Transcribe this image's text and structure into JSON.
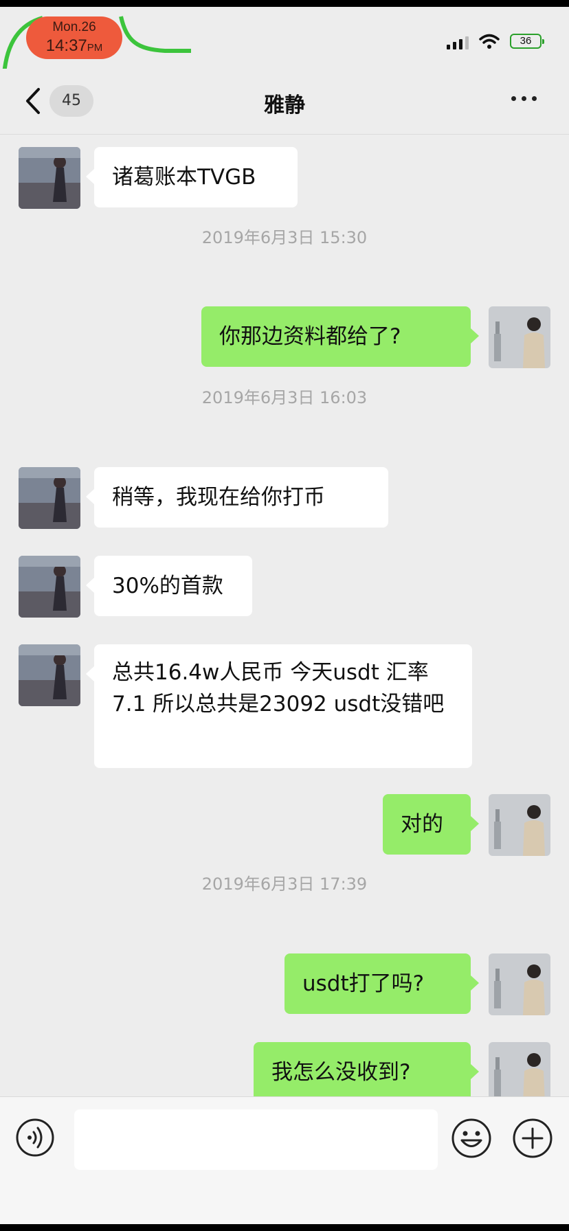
{
  "status_bar": {
    "date": "Mon.26",
    "time": "14:37",
    "ampm": "PM",
    "battery": "36",
    "accent_color": "#ee5a3c",
    "icons": [
      "signal-icon",
      "wifi-icon",
      "battery-icon"
    ]
  },
  "nav": {
    "back_icon": "chevron-left-icon",
    "unread_count": "45",
    "title": "雅静",
    "more_icon": "more-dots-icon"
  },
  "messages": [
    {
      "type": "in",
      "text": "诸葛账本TVGB"
    },
    {
      "type": "time",
      "text": "2019年6月3日 15:30"
    },
    {
      "type": "out",
      "text": "你那边资料都给了?"
    },
    {
      "type": "time",
      "text": "2019年6月3日 16:03"
    },
    {
      "type": "in",
      "text": "稍等，我现在给你打币"
    },
    {
      "type": "in",
      "text": "30%的首款"
    },
    {
      "type": "in",
      "text": "总共16.4w人民币 今天usdt 汇率7.1 所以总共是23092 usdt没错吧"
    },
    {
      "type": "out",
      "text": "对的"
    },
    {
      "type": "time",
      "text": "2019年6月3日 17:39"
    },
    {
      "type": "out",
      "text": "usdt打了吗?"
    },
    {
      "type": "out",
      "text": "我怎么没收到?"
    }
  ],
  "input_bar": {
    "icons": [
      "voice-icon",
      "emoji-icon",
      "plus-icon"
    ],
    "text_value": ""
  },
  "colors": {
    "background": "#ededed",
    "incoming_bubble": "#ffffff",
    "outgoing_bubble": "#95ec69",
    "timestamp_text": "#a6a6a6"
  }
}
